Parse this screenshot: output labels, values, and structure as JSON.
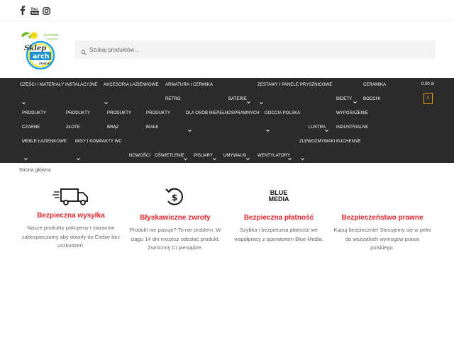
{
  "social": {
    "facebook": "facebook-icon",
    "youtube": "youtube-icon",
    "instagram": "instagram-icon"
  },
  "logo": {
    "tagline_1": "łazienki",
    "tagline_2": "i wnętrza",
    "name_1": "Sklep",
    "name_2": "arch",
    "name_3": "Instal"
  },
  "search": {
    "placeholder": "Szukaj produktów…"
  },
  "nav": {
    "items": [
      "CZĘŚCI I MATERIAŁY INSTALACYJNE",
      "AKCESORIA ŁAZIENKOWE",
      "ARMATURA I CERMIKA",
      "ZESTAWY I PANELE PRYSZNICOWE",
      "CERAMIKA",
      "RETRO",
      "BATERIE",
      "BIDETY",
      "BOCCHI",
      "PRODUKTY",
      "PRODUKTY",
      "PRODUKTY",
      "PRODUKTY",
      "DLA OSÓB NIEPEŁNOSPRAWNYCH",
      "GOCCIA POLSKA",
      "WYPOSAŻENIE",
      "CZARNE",
      "ZŁOTE",
      "BRĄZ",
      "BIAŁE",
      "LUSTRA",
      "INDUSTRIALNE",
      "MEBLE ŁAZIENKOWE",
      "MISY I KOMPAKTY WC",
      "ZLEWOZMYWAKI KUCHENNE",
      "NOWOŚCI",
      "OŚWIETLENIE",
      "PISUARY",
      "UMYWALKI",
      "WENTYLATORY"
    ],
    "cart_total": "0,00 zł",
    "cart_count": "0"
  },
  "breadcrumb": "Strona główna",
  "features": [
    {
      "icon": "delivery-truck-icon",
      "title": "Bezpieczna wysyłka",
      "text": "Nasze produkty pakujemy i starannie zabezpieczamy aby dotarły do Ciebie bez uszkodzeń."
    },
    {
      "icon": "money-return-icon",
      "title": "Błyskawiczne zwroty",
      "text": "Produkt nie pasuje? To nie problem. W ciągu 14 dni możesz odesłać produkt. Zwrócimy Ci pieniądze."
    },
    {
      "icon": "blue-media-logo",
      "logo_line_1": "BLUE",
      "logo_line_2": "MEDIA",
      "title": "Bezpieczna płatność",
      "text": "Szybka i bezpieczna płatność we współpracy z operatorem Blue Media."
    },
    {
      "icon": "legal-shield-icon",
      "title": "Bezpieczeństwo prawne",
      "text": "Kupuj bezpiecznie! Stosujemy się w pełni do wszystkich wymogów prawa polskiego."
    }
  ]
}
